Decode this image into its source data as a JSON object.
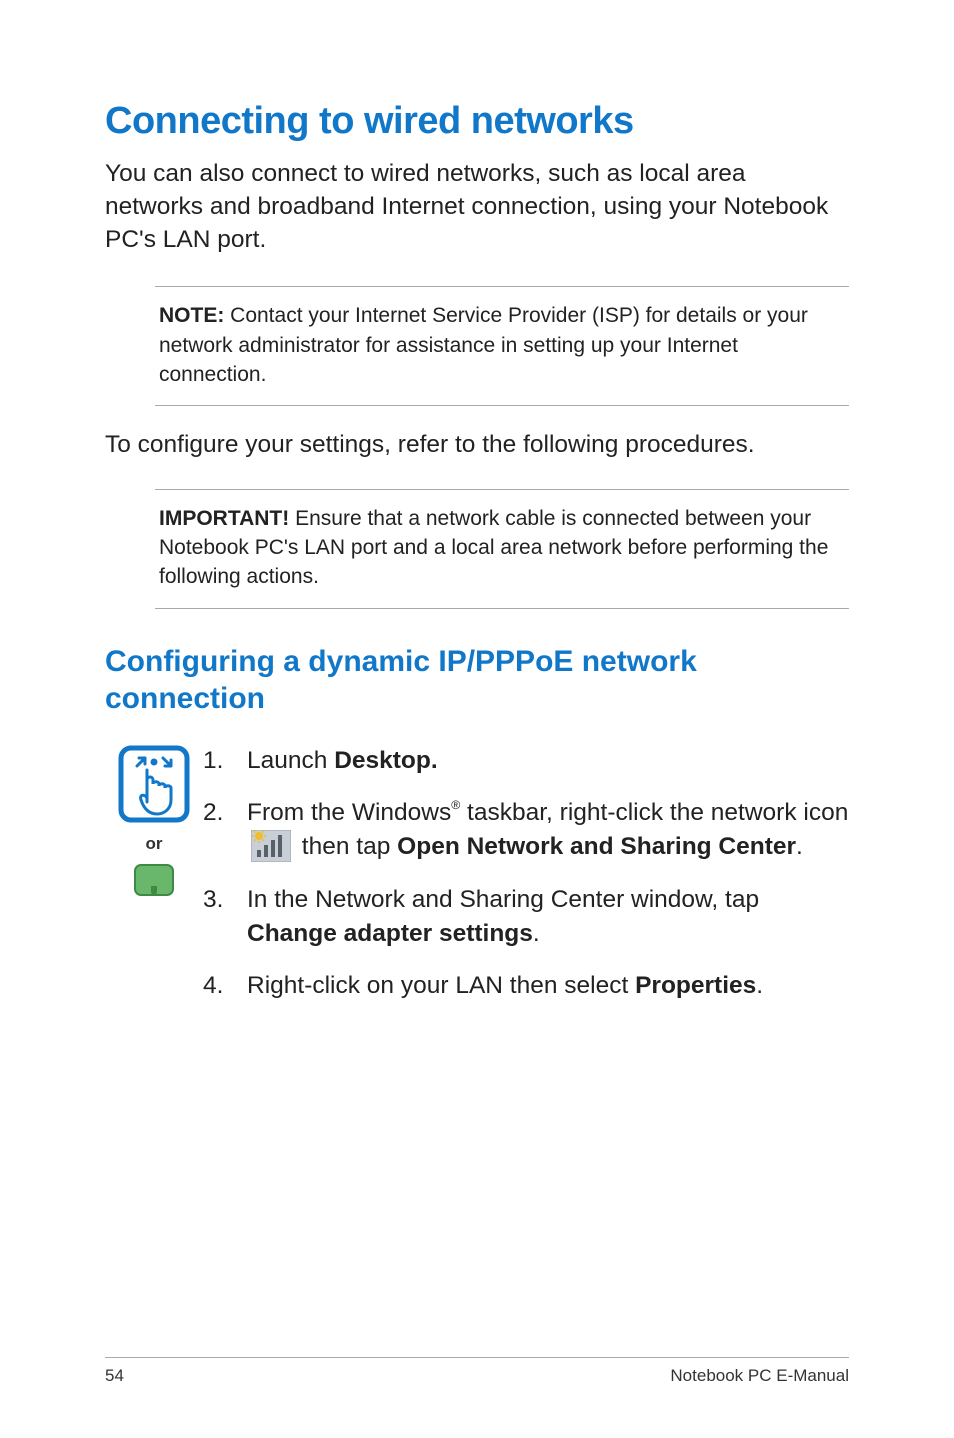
{
  "heading": "Connecting to wired networks",
  "intro": "You can also connect to wired networks, such as local area networks and broadband Internet connection, using your Notebook PC's LAN port.",
  "note_label": "NOTE:",
  "note_text": " Contact your Internet Service Provider (ISP) for details or your network administrator for assistance in setting up your Internet connection.",
  "configure_line": "To configure your settings, refer to the following procedures.",
  "important_label": "IMPORTANT!",
  "important_text": "  Ensure that a network cable is connected between your Notebook PC's LAN port and a local area network before performing the following actions.",
  "subheading": "Configuring a dynamic IP/PPPoE network connection",
  "or_label": "or",
  "steps": {
    "s1": {
      "num": "1.",
      "pre": "Launch ",
      "bold": "Desktop."
    },
    "s2": {
      "num": "2.",
      "pre1": "From the Windows",
      "reg": "®",
      "pre2": " taskbar, right-click the network icon ",
      "mid": " then tap ",
      "bold": "Open Network and Sharing Center",
      "suf": "."
    },
    "s3": {
      "num": "3.",
      "pre": "In the Network and Sharing Center window, tap ",
      "bold": "Change adapter settings",
      "suf": "."
    },
    "s4": {
      "num": "4.",
      "pre": "Right-click on your LAN then select ",
      "bold": "Properties",
      "suf": "."
    }
  },
  "footer": {
    "page": "54",
    "title": "Notebook PC E-Manual"
  },
  "icons": {
    "touch": "touch-gesture-icon",
    "touchpad": "touchpad-icon",
    "network": "network-tray-icon"
  }
}
